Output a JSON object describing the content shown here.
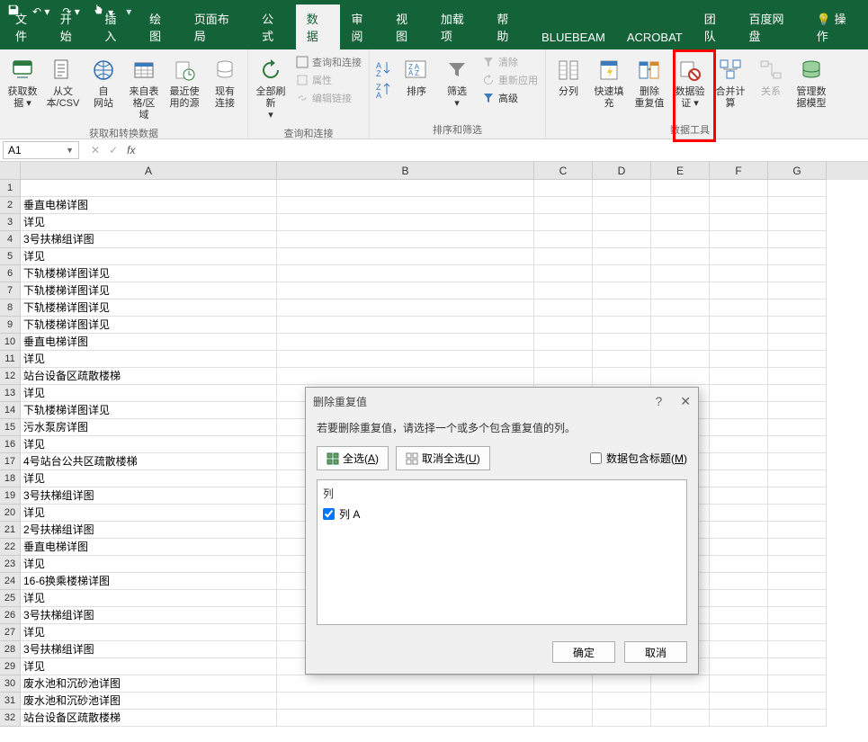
{
  "qat": {
    "save": "💾",
    "undo": "↶",
    "redo": "↷",
    "touch": "👆"
  },
  "tabs": {
    "items": [
      "文件",
      "开始",
      "插入",
      "绘图",
      "页面布局",
      "公式",
      "数据",
      "审阅",
      "视图",
      "加载项",
      "帮助",
      "BLUEBEAM",
      "ACROBAT",
      "团队",
      "百度网盘"
    ],
    "active_idx": 6,
    "right": "操作"
  },
  "ribbon": {
    "groups": {
      "g1": {
        "label": "获取和转换数据",
        "btns": [
          "获取数\n据 ▾",
          "从文\n本/CSV",
          "自\n网站",
          "来自表\n格/区域",
          "最近使\n用的源",
          "现有\n连接"
        ]
      },
      "g2": {
        "label": "查询和连接",
        "big": "全部刷新\n▾",
        "small": [
          "查询和连接",
          "属性",
          "编辑链接"
        ]
      },
      "g3": {
        "label": "排序和筛选",
        "btns": [
          "排序",
          "筛选\n▾"
        ],
        "small": [
          "清除",
          "重新应用",
          "高级"
        ]
      },
      "g4": {
        "label": "数据工具",
        "btns": [
          "分列",
          "快速填充",
          "删除\n重复值",
          "数据验\n证 ▾",
          "合并计算",
          "关系",
          "管理数\n据模型"
        ]
      }
    }
  },
  "namebox": "A1",
  "columns": [
    "A",
    "B",
    "C",
    "D",
    "E",
    "F",
    "G"
  ],
  "cells": {
    "1": "",
    "2": "垂直电梯详图",
    "3": "详见",
    "4": "3号扶梯组详图",
    "5": "详见",
    "6": "下轨楼梯详图详见",
    "7": "下轨楼梯详图详见",
    "8": "下轨楼梯详图详见",
    "9": "下轨楼梯详图详见",
    "10": "垂直电梯详图",
    "11": "详见",
    "12": "站台设备区疏散楼梯",
    "13": "详见",
    "14": "下轨楼梯详图详见",
    "15": "污水泵房详图",
    "16": "详见",
    "17": "4号站台公共区疏散楼梯",
    "18": "详见",
    "19": "3号扶梯组详图",
    "20": "详见",
    "21": "2号扶梯组详图",
    "22": "垂直电梯详图",
    "23": "详见",
    "24": "16-6换乘楼梯详图",
    "25": "详见",
    "26": "3号扶梯组详图",
    "27": "详见",
    "28": "3号扶梯组详图",
    "29": "详见",
    "30": "废水池和沉砂池详图",
    "31": "废水池和沉砂池详图",
    "32": "站台设备区疏散楼梯"
  },
  "dialog": {
    "title": "删除重复值",
    "instr": "若要删除重复值，请选择一个或多个包含重复值的列。",
    "select_all": "全选(A)",
    "unselect_all": "取消全选(U)",
    "header_chk": "数据包含标题(M)",
    "list_hdr": "列",
    "item1": "列 A",
    "ok": "确定",
    "cancel": "取消"
  }
}
